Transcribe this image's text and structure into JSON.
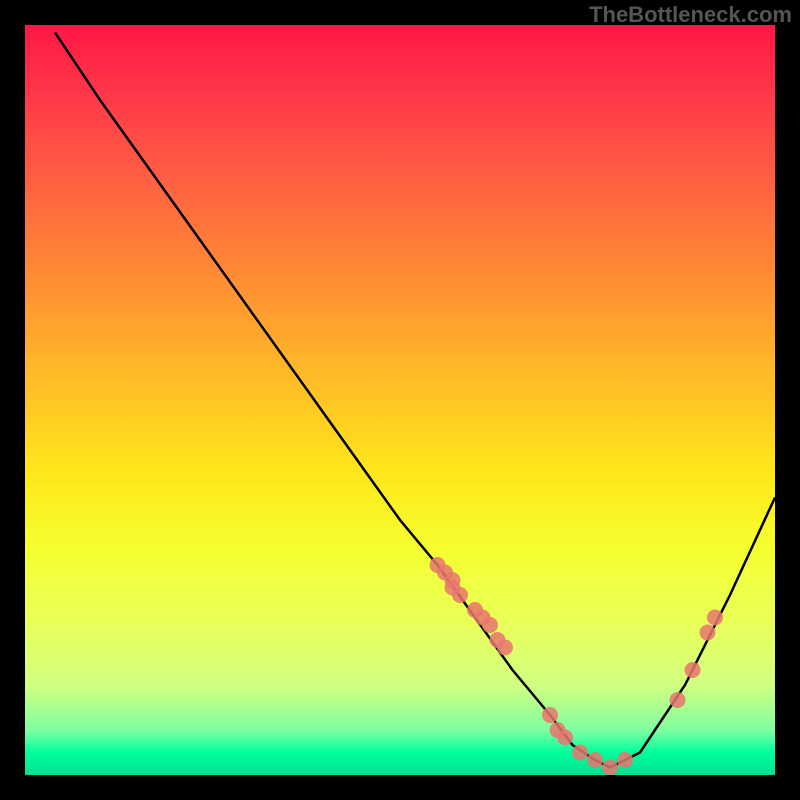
{
  "watermark": "TheBottleneck.com",
  "chart_data": {
    "type": "line",
    "title": "",
    "xlabel": "",
    "ylabel": "",
    "xlim": [
      0,
      100
    ],
    "ylim": [
      0,
      100
    ],
    "grid": false,
    "legend": false,
    "series": [
      {
        "name": "bottleneck-curve",
        "type": "line",
        "color": "#000000",
        "x": [
          4,
          10,
          20,
          30,
          40,
          50,
          55,
          60,
          65,
          70,
          73,
          76,
          78,
          82,
          88,
          94,
          100
        ],
        "y": [
          99,
          90,
          76,
          62,
          48,
          34,
          28,
          21,
          14,
          8,
          4,
          2,
          1,
          3,
          12,
          24,
          37
        ]
      },
      {
        "name": "data-points",
        "type": "scatter",
        "color": "#e8766f",
        "radius": 8,
        "x": [
          55,
          56,
          57,
          57,
          58,
          60,
          61,
          62,
          63,
          64,
          70,
          71,
          72,
          74,
          76,
          78,
          80,
          87,
          89,
          91,
          92
        ],
        "y": [
          28,
          27,
          26,
          25,
          24,
          22,
          21,
          20,
          18,
          17,
          8,
          6,
          5,
          3,
          2,
          1,
          2,
          10,
          14,
          19,
          21
        ]
      }
    ],
    "background_gradient": {
      "type": "vertical",
      "stops": [
        {
          "pos": 0,
          "color": "#ff1744"
        },
        {
          "pos": 50,
          "color": "#ffc524"
        },
        {
          "pos": 85,
          "color": "#e8ff5a"
        },
        {
          "pos": 100,
          "color": "#00e090"
        }
      ]
    }
  }
}
